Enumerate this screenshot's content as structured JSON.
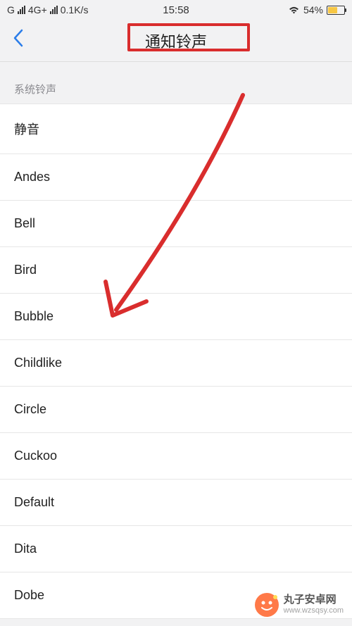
{
  "status_bar": {
    "carrier": "G",
    "network": "4G+",
    "speed": "0.1K/s",
    "time": "15:58",
    "battery_pct": "54%"
  },
  "header": {
    "title": "通知铃声"
  },
  "section": {
    "label": "系统铃声"
  },
  "ringtones": [
    "静音",
    "Andes",
    "Bell",
    "Bird",
    "Bubble",
    "Childlike",
    "Circle",
    "Cuckoo",
    "Default",
    "Dita",
    "Dobe"
  ],
  "watermark": {
    "name": "丸子安卓网",
    "url": "www.wzsqsy.com"
  }
}
